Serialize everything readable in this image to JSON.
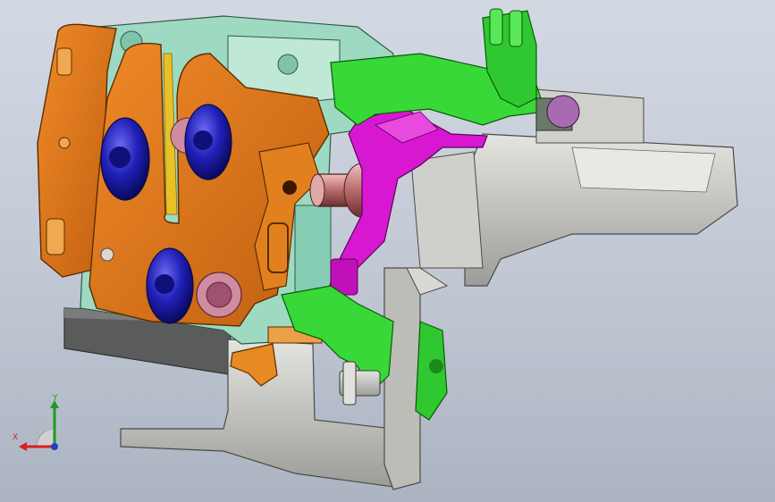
{
  "viewport": {
    "background_top": "#d3d9e3",
    "background_bottom": "#acb4c2"
  },
  "part_colors": {
    "housing_orange": "#e07818",
    "fastener_blue": "#2020b8",
    "lever_magenta": "#d818d0",
    "frame_green": "#38d838",
    "bracket_gray": "#c8c8c4",
    "housing_teal": "#9ed9c2",
    "shaft_rose": "#d08a8a",
    "base_dark": "#5a5c5c",
    "trim_yellow": "#e8c028"
  },
  "triad": {
    "x_label": "X",
    "y_label": "Y",
    "x_color": "#d82020",
    "y_color": "#1f9a1f",
    "z_color": "#2040c8"
  }
}
